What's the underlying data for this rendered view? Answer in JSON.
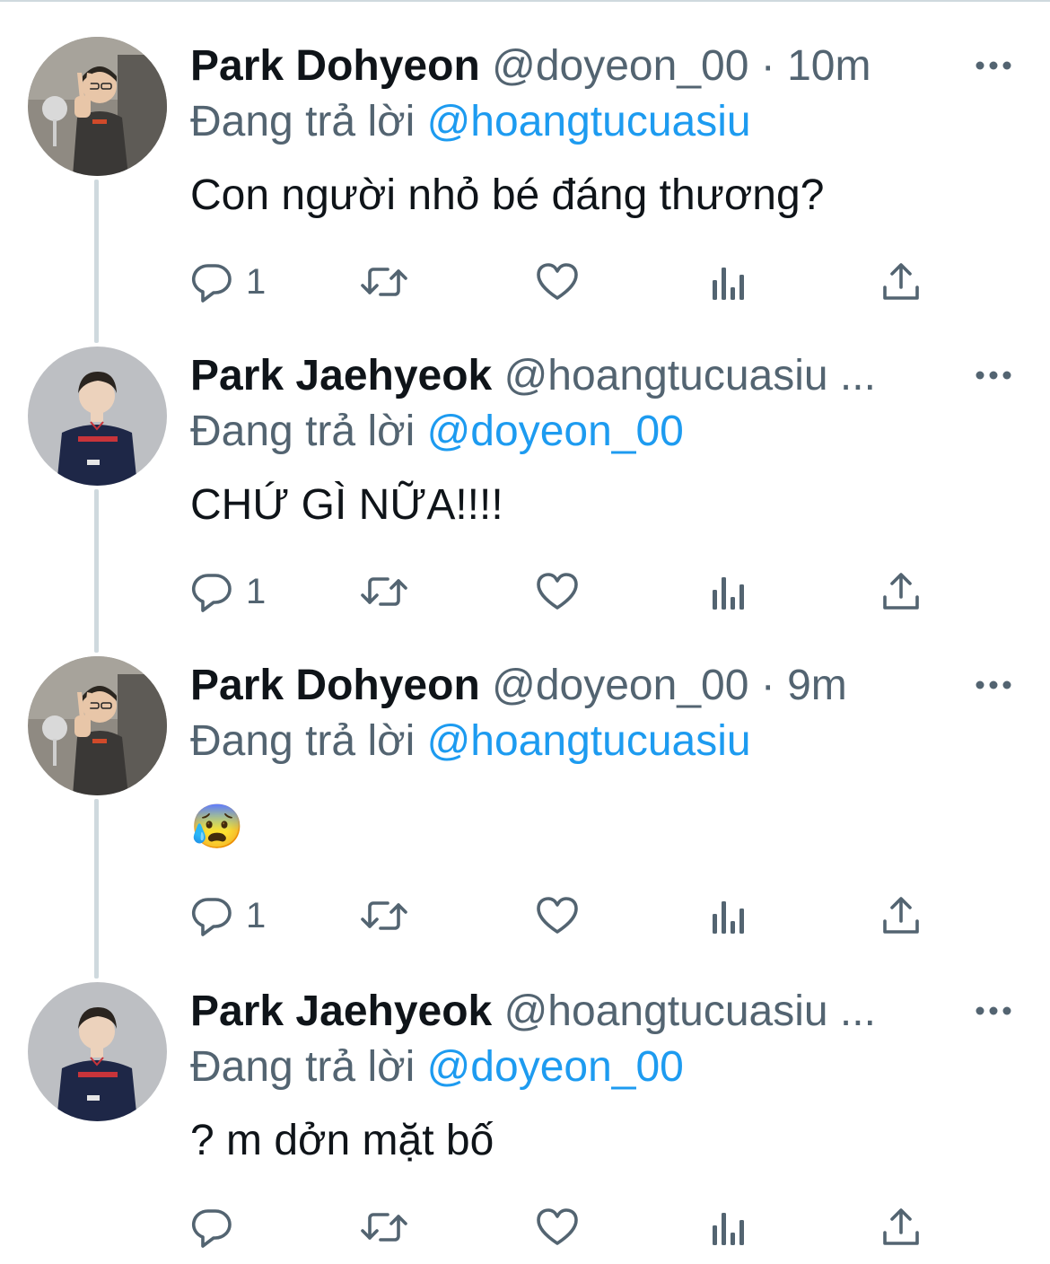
{
  "thread": {
    "tweets": [
      {
        "display_name": "Park Dohyeon",
        "handle": "@doyeon_00",
        "separator": " · ",
        "time": "10m",
        "ellipsis": "",
        "reply_prefix": "Đang trả lời ",
        "reply_to": "@hoangtucuasiu",
        "text": "Con người nhỏ bé đáng thương?",
        "reply_count": "1",
        "avatar": "person-peace-sign"
      },
      {
        "display_name": "Park Jaehyeok",
        "handle": "@hoangtucuasiu",
        "separator": "",
        "time": "",
        "ellipsis": " ...",
        "reply_prefix": "Đang trả lời ",
        "reply_to": "@doyeon_00",
        "text": "CHỨ GÌ NỮA!!!!",
        "reply_count": "1",
        "avatar": "person-jersey"
      },
      {
        "display_name": "Park Dohyeon",
        "handle": "@doyeon_00",
        "separator": " · ",
        "time": "9m",
        "ellipsis": "",
        "reply_prefix": "Đang trả lời ",
        "reply_to": "@hoangtucuasiu",
        "text": "😰",
        "reply_count": "1",
        "avatar": "person-peace-sign"
      },
      {
        "display_name": "Park Jaehyeok",
        "handle": "@hoangtucuasiu",
        "separator": "",
        "time": "",
        "ellipsis": " ...",
        "reply_prefix": "Đang trả lời ",
        "reply_to": "@doyeon_00",
        "text": "? m dởn mặt bố",
        "reply_count": "",
        "avatar": "person-jersey"
      }
    ]
  },
  "icons": {
    "more": "more-horizontal-icon",
    "reply": "reply-bubble-icon",
    "retweet": "retweet-icon",
    "like": "heart-icon",
    "views": "views-bar-chart-icon",
    "share": "share-upload-icon"
  },
  "colors": {
    "text": "#0f1419",
    "secondary": "#536471",
    "link": "#1d9bf0",
    "thread_line": "#cfd9de"
  }
}
